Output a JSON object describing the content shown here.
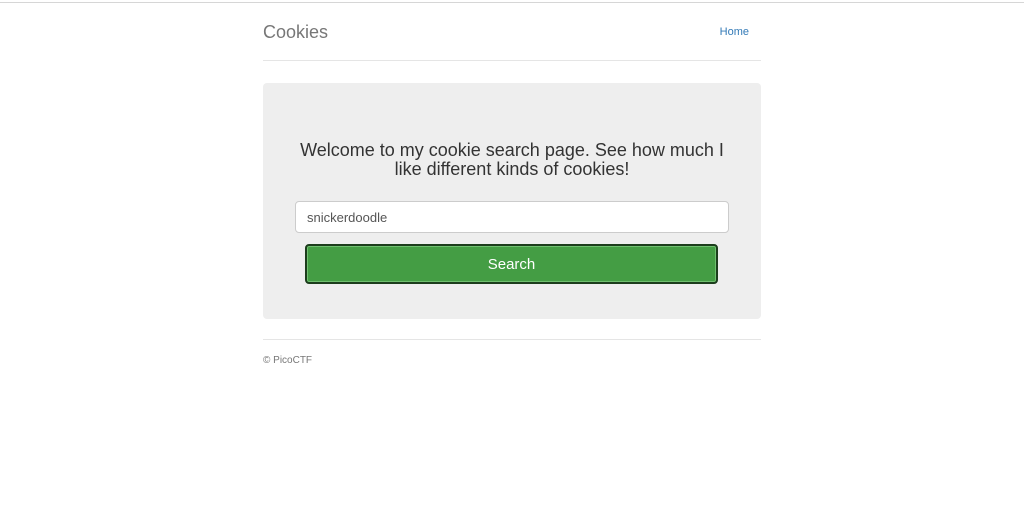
{
  "header": {
    "brand": "Cookies",
    "nav_home": "Home"
  },
  "main": {
    "welcome_text": "Welcome to my cookie search page. See how much I like different kinds of cookies!",
    "search_value": "snickerdoodle",
    "search_button_label": "Search"
  },
  "footer": {
    "copyright": "© PicoCTF"
  },
  "colors": {
    "search_button": "#449d44",
    "link": "#337ab7",
    "jumbotron_bg": "#eeeeee"
  }
}
